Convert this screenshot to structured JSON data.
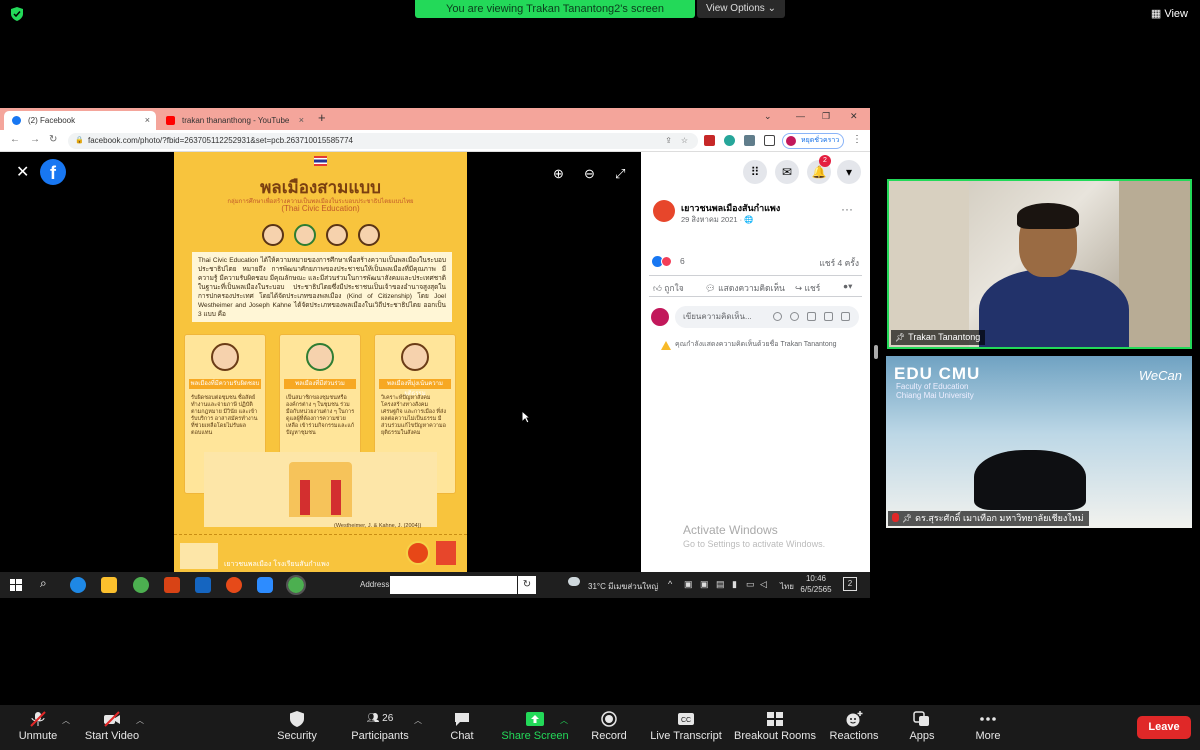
{
  "zoom_header": {
    "viewing_banner": "You are viewing Trakan Tanantong2's screen",
    "view_options": "View Options",
    "view_button": "View"
  },
  "browser": {
    "tabs": [
      {
        "label": "(2) Facebook",
        "favicon_color": "#1877f2"
      },
      {
        "label": "trakan thananthong - YouTube",
        "favicon_color": "#ff0000"
      }
    ],
    "url": "facebook.com/photo/?fbid=263705112252931&set=pcb.263710015585774",
    "profile_chip": "หยุดชั่วคราว",
    "new_tab": "+",
    "close_tab": "×"
  },
  "photo_viewer": {
    "close": "✕",
    "logo_letter": "f",
    "tools": [
      "zoom-in",
      "zoom-out",
      "fullscreen"
    ]
  },
  "poster": {
    "title": "พลเมืองสามแบบ",
    "subtitle": "กลุ่มการศึกษาเพื่อสร้างความเป็นพลเมืองในระบอบประชาธิปไตยแบบไทย",
    "subtitle_en": "(Thai Civic Education)",
    "body": "Thai Civic Education ได้ให้ความหมายของการศึกษาเพื่อสร้างความเป็นพลเมืองในระบอบประชาธิปไตย หมายถึง การพัฒนาศักยภาพของประชาชนให้เป็นพลเมืองที่มีคุณภาพ มีความรู้ มีความรับผิดชอบ มีคุณลักษณะ และมีส่วนร่วมในการพัฒนาสังคมและประเทศชาติ ในฐานะที่เป็นพลเมืองในระบอบ ประชาธิปไตยซึ่งมีประชาชนเป็นเจ้าของอำนาจสูงสุดในการปกครองประเทศ โดยได้จัดประเภทของพลเมือง (Kind of Citizenship) โดย Joel Westheimer and Joseph Kahne ได้จัดประเภทของพลเมืองในเวิถีประชาธิปไตย ออกเป็น 3 แบบ คือ",
    "types": [
      {
        "label": "พลเมืองที่มีความรับผิดชอบ",
        "text": "รับผิดชอบต่อชุมชน ซื่อสัตย์ ทำงานและจ่ายภาษี ปฏิบัติตามกฎหมาย มีวินัย และเข้ารับบริการ อาสาสมัครทำงานที่ช่วยเหลือโดยไม่รับผลตอบแทน"
      },
      {
        "label": "พลเมืองที่มีส่วนร่วม",
        "text": "เป็นสมาชิกของชุมชนหรือองค์กรต่าง ๆ ในชุมชน ร่วมมือกับหน่วยงานต่าง ๆ ในการดูแลผู้ที่ต้องการความช่วยเหลือ เข้าร่วมกิจกรรมและแก้ปัญหาชุมชน"
      },
      {
        "label": "พลเมืองที่มุ่งเน้นความยุติธรรม",
        "text": "วิเคราะห์ปัญหาสังคม โครงสร้างทางสังคม เศรษฐกิจ และการเมือง ที่ส่งผลต่อความไม่เป็นธรรม มีส่วนร่วมแก้ไขปัญหาความอยุติธรรมในสังคม"
      }
    ],
    "citation": "(Westheimer, J. & Kahne, J. (2004))",
    "footer": "เยาวชนพลเมือง โรงเรียนสันกำแพง"
  },
  "fb_panel": {
    "page_name": "เยาวชนพลเมืองสันกำแพง",
    "post_date": "29 สิงหาคม 2021 · 🌐",
    "reaction_count": "6",
    "share_count": "แชร์ 4 ครั้ง",
    "like_label": "ถูกใจ",
    "comment_label": "แสดงความคิดเห็น",
    "share_label": "แชร์",
    "comment_placeholder": "เขียนความคิดเห็น...",
    "comment_warning": "คุณกำลังแสดงความคิดเห็นด้วยชื่อ Trakan Tanantong",
    "notification_count": "2",
    "activate_title": "Activate Windows",
    "activate_sub": "Go to Settings to activate Windows."
  },
  "taskbar": {
    "address_label": "Address",
    "weather": "31°C มีเมฆส่วนใหญ่",
    "language": "ไทย",
    "time": "10:46",
    "date": "6/5/2565",
    "notification": "2"
  },
  "participants": [
    {
      "name": "Trakan Tanantong",
      "active_speaker": true
    },
    {
      "name": "ดร.สุระศักดิ์ เมาเทือก มหาวิทยาลัยเชียงใหม่",
      "muted": true,
      "background_logo": "EDU CMU",
      "background_sub1": "Faculty of Education",
      "background_sub2": "Chiang Mai University",
      "background_tagline": "WeCan"
    }
  ],
  "toolbar": {
    "unmute": "Unmute",
    "start_video": "Start Video",
    "security": "Security",
    "participants": "Participants",
    "participants_count": "26",
    "chat": "Chat",
    "share_screen": "Share Screen",
    "record": "Record",
    "live_transcript": "Live Transcript",
    "breakout_rooms": "Breakout Rooms",
    "reactions": "Reactions",
    "apps": "Apps",
    "more": "More",
    "leave": "Leave"
  },
  "colors": {
    "zoom_green": "#23d959",
    "leave_red": "#e02828",
    "facebook_blue": "#1877f2",
    "poster_yellow": "#f8c43d",
    "tab_strip": "#f4a59b"
  }
}
